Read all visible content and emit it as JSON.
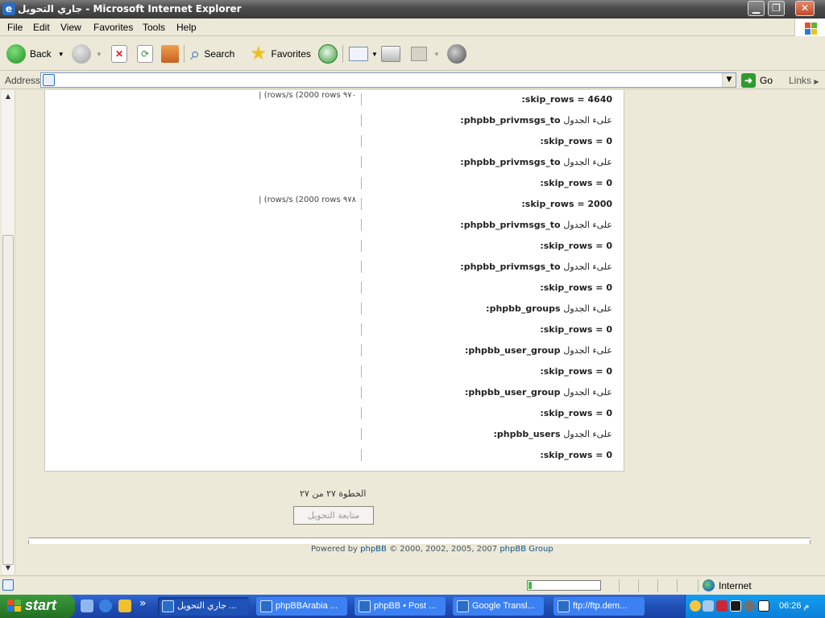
{
  "window": {
    "title": "جاري التحويل - Microsoft Internet Explorer",
    "minimize": "▁",
    "maximize": "❐",
    "close": "✕"
  },
  "menu": [
    "File",
    "Edit",
    "View",
    "Favorites",
    "Tools",
    "Help"
  ],
  "toolbar": {
    "back": "Back",
    "search": "Search",
    "favorites": "Favorites"
  },
  "address": {
    "label": "Address",
    "value": "",
    "go": "Go",
    "links": "Links"
  },
  "rows": [
    {
      "prefix": "",
      "table": "",
      "text": ":skip_rows = 4640",
      "side": "| (rows/s (2000 rows ٩٧٠"
    },
    {
      "prefix": "علىء الجدول",
      "table": ":phpbb_privmsgs_to",
      "text": "",
      "side": ""
    },
    {
      "prefix": "",
      "table": "",
      "text": ":skip_rows = 0",
      "side": ""
    },
    {
      "prefix": "علىء الجدول",
      "table": ":phpbb_privmsgs_to",
      "text": "",
      "side": ""
    },
    {
      "prefix": "",
      "table": "",
      "text": ":skip_rows = 0",
      "side": ""
    },
    {
      "prefix": "",
      "table": "",
      "text": ":skip_rows = 2000",
      "side": "| (rows/s (2000 rows ٩٧٨"
    },
    {
      "prefix": "علىء الجدول",
      "table": ":phpbb_privmsgs_to",
      "text": "",
      "side": ""
    },
    {
      "prefix": "",
      "table": "",
      "text": ":skip_rows = 0",
      "side": ""
    },
    {
      "prefix": "علىء الجدول",
      "table": ":phpbb_privmsgs_to",
      "text": "",
      "side": ""
    },
    {
      "prefix": "",
      "table": "",
      "text": ":skip_rows = 0",
      "side": ""
    },
    {
      "prefix": "علىء الجدول",
      "table": ":phpbb_groups",
      "text": "",
      "side": ""
    },
    {
      "prefix": "",
      "table": "",
      "text": ":skip_rows = 0",
      "side": ""
    },
    {
      "prefix": "علىء الجدول",
      "table": ":phpbb_user_group",
      "text": "",
      "side": ""
    },
    {
      "prefix": "",
      "table": "",
      "text": ":skip_rows = 0",
      "side": ""
    },
    {
      "prefix": "علىء الجدول",
      "table": ":phpbb_user_group",
      "text": "",
      "side": ""
    },
    {
      "prefix": "",
      "table": "",
      "text": ":skip_rows = 0",
      "side": ""
    },
    {
      "prefix": "علىء الجدول",
      "table": ":phpbb_users",
      "text": "",
      "side": ""
    },
    {
      "prefix": "",
      "table": "",
      "text": ":skip_rows = 0",
      "side": ""
    }
  ],
  "step": {
    "text": "الخطوة ٢٧ من ٢٧",
    "button": "متابعة التحويل"
  },
  "footer": {
    "prefix": "Powered by ",
    "phpbb": "phpBB",
    "middle": " © 2000, 2002, 2005, 2007 ",
    "group": "phpBB Group"
  },
  "status": {
    "progress": 0.05,
    "zone": "Internet"
  },
  "taskbar": {
    "start": "start",
    "chevron": "»",
    "tasks": [
      {
        "label": "جاري التحويل ...",
        "active": true
      },
      {
        "label": "phpBBArabia ...",
        "active": false
      },
      {
        "label": "phpBB • Post ...",
        "active": false
      },
      {
        "label": "Google Transl...",
        "active": false
      },
      {
        "label": "ftp://ftp.dem...",
        "active": false
      }
    ],
    "clock": "06:26 م"
  },
  "colors": {
    "accent": "#105289",
    "taskbar": "#1f4fb3",
    "start": "#2e862e"
  }
}
